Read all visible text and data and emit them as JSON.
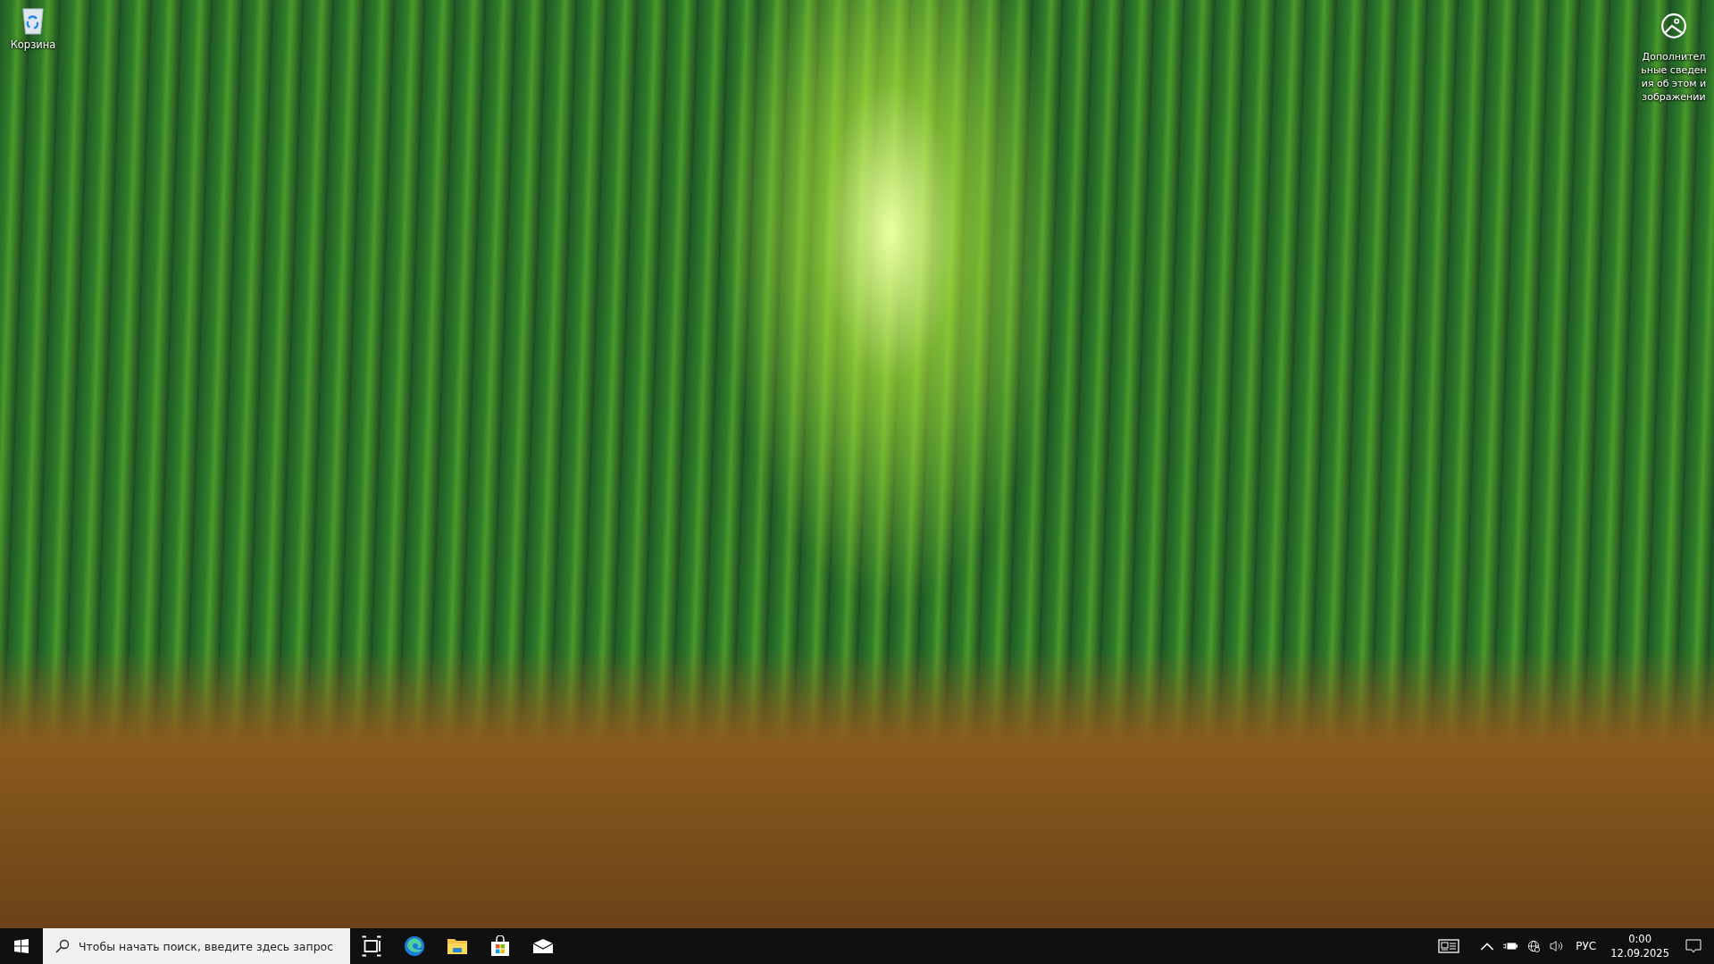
{
  "desktop": {
    "icons": [
      {
        "label": "Корзина"
      }
    ],
    "spotlight": {
      "label": "Дополнительные сведения об этом изображении"
    }
  },
  "taskbar": {
    "search": {
      "placeholder": "Чтобы начать поиск, введите здесь запрос"
    },
    "tray": {
      "language": "РУС",
      "time": "0:00",
      "date": "12.09.2025"
    }
  }
}
